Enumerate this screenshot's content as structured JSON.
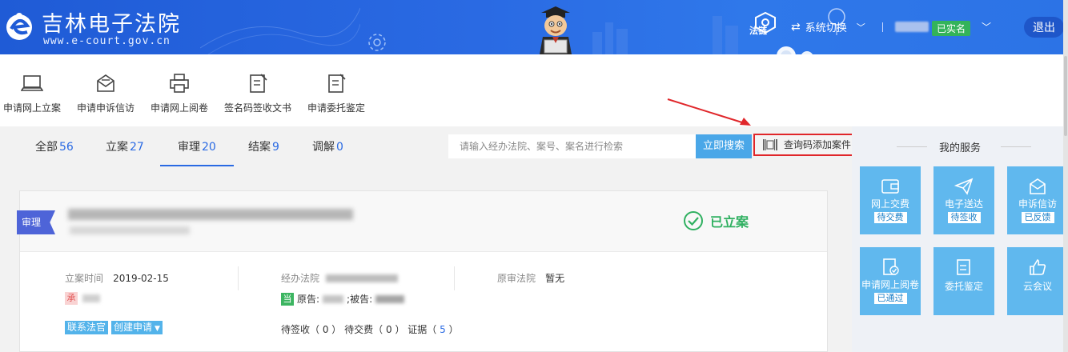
{
  "header": {
    "title": "吉林电子法院",
    "url": "www.e-court.gov.cn",
    "chain_label": "法链",
    "switch_label": "系统切换",
    "verified_badge": "已实名",
    "logout_label": "退出"
  },
  "toolbar": {
    "items": [
      {
        "label": "申请网上立案",
        "icon": "laptop-icon"
      },
      {
        "label": "申请申诉信访",
        "icon": "mail-icon"
      },
      {
        "label": "申请网上阅卷",
        "icon": "printer-icon"
      },
      {
        "label": "签名码签收文书",
        "icon": "sign-doc-icon"
      },
      {
        "label": "申请委托鉴定",
        "icon": "edit-doc-icon"
      }
    ]
  },
  "tabs": [
    {
      "label": "全部",
      "count": "56"
    },
    {
      "label": "立案",
      "count": "27"
    },
    {
      "label": "审理",
      "count": "20"
    },
    {
      "label": "结案",
      "count": "9"
    },
    {
      "label": "调解",
      "count": "0"
    }
  ],
  "search": {
    "placeholder": "请输入经办法院、案号、案名进行检索",
    "button_label": "立即搜索",
    "add_case_label": "查询码添加案件"
  },
  "case": {
    "stage_ribbon": "审理",
    "status": "已立案",
    "filing_time_label": "立案时间",
    "filing_time": "2019-02-15",
    "court_label": "经办法院",
    "original_court_label": "原审法院",
    "original_court": "暂无",
    "undertaker_tag": "承",
    "party_tag": "当",
    "plaintiff_label": "原告:",
    "defendant_label": ";被告:",
    "contact_judge_label": "联系法官",
    "create_request_label": "创建申请",
    "pending_sign_label": "待签收",
    "pending_sign_count": "0",
    "pending_pay_label": "待交费",
    "pending_pay_count": "0",
    "evidence_label": "证据",
    "evidence_count": "5"
  },
  "services": {
    "title": "我的服务",
    "items": [
      {
        "label": "网上交费",
        "badge": "待交费"
      },
      {
        "label": "电子送达",
        "badge": "待签收"
      },
      {
        "label": "申诉信访",
        "badge": "已反馈"
      },
      {
        "label": "申请网上阅卷",
        "badge": "已通过"
      },
      {
        "label": "委托鉴定",
        "badge": ""
      },
      {
        "label": "云会议",
        "badge": ""
      }
    ]
  },
  "colors": {
    "header_blue": "#2a6ae3",
    "service_tile": "#60b8ee",
    "status_green": "#2fb060",
    "highlight_red": "#e0262a"
  }
}
